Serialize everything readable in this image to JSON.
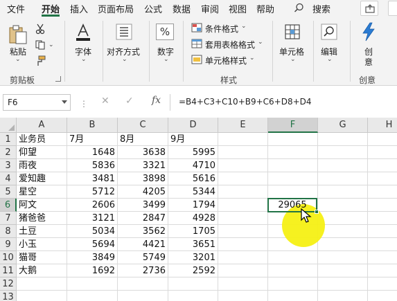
{
  "menu": {
    "tabs": [
      "文件",
      "开始",
      "插入",
      "页面布局",
      "公式",
      "数据",
      "审阅",
      "视图",
      "帮助"
    ],
    "active_tab": "开始",
    "search_label": "搜索",
    "accent_color": "#217346"
  },
  "ribbon": {
    "clipboard": {
      "paste_label": "粘贴",
      "group_label": "剪贴板"
    },
    "font": {
      "label": "字体"
    },
    "alignment": {
      "label": "对齐方式"
    },
    "number": {
      "label": "数字",
      "symbol": "%"
    },
    "styles": {
      "conditional_format": "条件格式",
      "table_format": "套用表格格式",
      "cell_styles": "单元格样式",
      "group_label": "样式"
    },
    "cells": {
      "label": "单元格"
    },
    "editing": {
      "label": "编辑"
    },
    "create": {
      "label_line1": "创",
      "label_line2": "意",
      "group_label": "创意"
    }
  },
  "formula_bar": {
    "name_box": "F6",
    "fx_label": "fx",
    "formula": "=B4+C3+C10+B9+C6+D8+D4"
  },
  "sheet": {
    "columns": [
      "A",
      "B",
      "C",
      "D",
      "E",
      "F",
      "G",
      "H"
    ],
    "selected_column": "F",
    "row_numbers": [
      "1",
      "2",
      "3",
      "4",
      "5",
      "6",
      "7",
      "8",
      "9",
      "10",
      "11",
      "12",
      "13"
    ],
    "selected_row": "6",
    "headers": [
      "业务员",
      "7月",
      "8月",
      "9月"
    ],
    "rows": [
      [
        "仰望",
        "1648",
        "3638",
        "5995"
      ],
      [
        "雨夜",
        "5836",
        "3321",
        "4710"
      ],
      [
        "爱知趣",
        "3481",
        "3898",
        "5616"
      ],
      [
        "星空",
        "5712",
        "4205",
        "5344"
      ],
      [
        "阿文",
        "2606",
        "3499",
        "1794"
      ],
      [
        "猪爸爸",
        "3121",
        "2847",
        "4928"
      ],
      [
        "土豆",
        "5034",
        "3562",
        "1705"
      ],
      [
        "小玉",
        "5694",
        "4421",
        "3651"
      ],
      [
        "猫哥",
        "3849",
        "5749",
        "3201"
      ],
      [
        "大鹅",
        "1692",
        "2736",
        "2592"
      ]
    ],
    "active_cell_value": "29065",
    "highlight_color": "#f5f014"
  }
}
